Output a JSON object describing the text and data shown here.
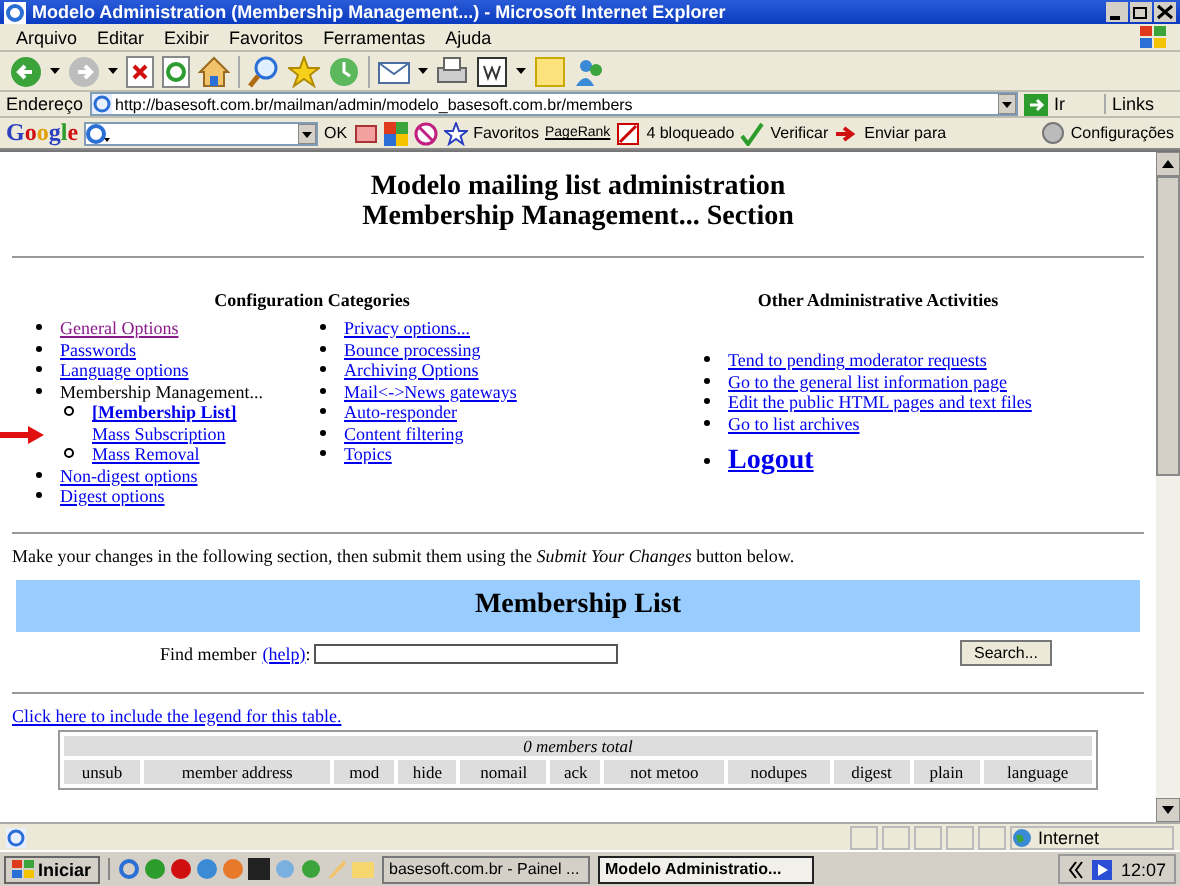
{
  "window": {
    "title": "Modelo Administration (Membership Management...) - Microsoft Internet Explorer"
  },
  "menu": [
    "Arquivo",
    "Editar",
    "Exibir",
    "Favoritos",
    "Ferramentas",
    "Ajuda"
  ],
  "address": {
    "label": "Endereço",
    "url": "http://basesoft.com.br/mailman/admin/modelo_basesoft.com.br/members",
    "go": "Ir",
    "links": "Links"
  },
  "google_bar": {
    "logo": "Google",
    "ok": "OK",
    "favorites": "Favoritos",
    "pagerank": "PageRank",
    "blocked": "4 bloqueado",
    "check": "Verificar",
    "send": "Enviar para",
    "settings": "Configurações"
  },
  "page": {
    "heading": [
      "Modelo mailing list administration",
      "Membership Management... Section"
    ],
    "config": {
      "title": "Configuration Categories",
      "column_1": [
        {
          "label": "General Options",
          "visited": true,
          "current": false
        },
        {
          "label": "Passwords",
          "visited": false,
          "current": false
        },
        {
          "label": "Language options",
          "visited": false,
          "current": false
        },
        {
          "label": "Membership Management...",
          "visited": false,
          "current": true,
          "children": [
            {
              "label": "[Membership List]",
              "visited": false,
              "current": true,
              "marked": false
            },
            {
              "label": "Mass Subscription",
              "visited": false,
              "current": false,
              "marked": true
            },
            {
              "label": "Mass Removal",
              "visited": false,
              "current": false,
              "marked": false
            }
          ]
        },
        {
          "label": "Non-digest options",
          "visited": false,
          "current": false
        },
        {
          "label": "Digest options",
          "visited": false,
          "current": false
        }
      ],
      "column_2": [
        {
          "label": "Privacy options...",
          "visited": false
        },
        {
          "label": "Bounce processing",
          "visited": false
        },
        {
          "label": "Archiving Options",
          "visited": false
        },
        {
          "label": "Mail<->News gateways",
          "visited": false
        },
        {
          "label": "Auto-responder",
          "visited": false
        },
        {
          "label": "Content filtering",
          "visited": false
        },
        {
          "label": "Topics",
          "visited": false
        }
      ]
    },
    "other": {
      "title": "Other Administrative Activities",
      "links": [
        "Tend to pending moderator requests",
        "Go to the general list information page",
        "Edit the public HTML pages and text files",
        "Go to list archives"
      ],
      "logout": "Logout"
    },
    "instructions": "Make your changes in the following section, then submit them using the *Submit Your Changes* button below.",
    "membership": {
      "title": "Membership List",
      "find_label": "Find member",
      "help": "(help)",
      "colon": ":",
      "search_button": "Search..."
    },
    "legend_link": "Click here to include the legend for this table.",
    "table": {
      "total": "0 members total",
      "columns": [
        "unsub",
        "member address",
        "mod",
        "hide",
        "nomail",
        "ack",
        "not metoo",
        "nodupes",
        "digest",
        "plain",
        "language"
      ]
    }
  },
  "status_bar": {
    "zone": "Internet"
  },
  "taskbar": {
    "start": "Iniciar",
    "tasks": [
      {
        "label": "basesoft.com.br - Painel ...",
        "selected": false
      },
      {
        "label": "Modelo Administratio...",
        "selected": true
      }
    ],
    "clock": "12:07"
  }
}
